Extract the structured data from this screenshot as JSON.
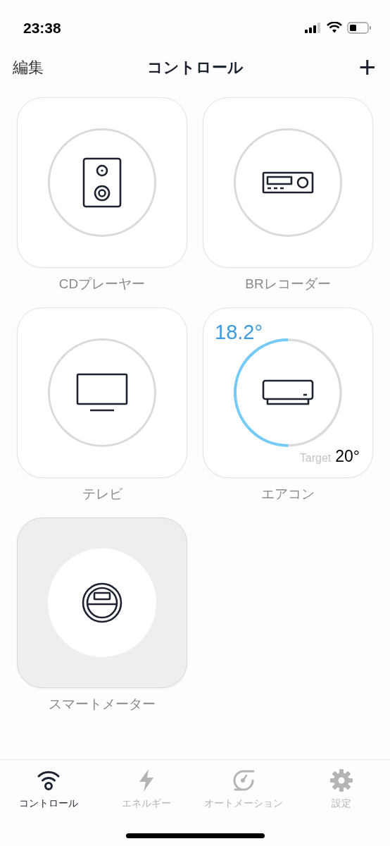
{
  "status_bar": {
    "time": "23:38"
  },
  "nav_bar": {
    "edit": "編集",
    "title": "コントロール",
    "add": "+"
  },
  "devices": [
    {
      "kind": "speaker",
      "name": "CDプレーヤー",
      "highlighted": false
    },
    {
      "kind": "recorder",
      "name": "BRレコーダー",
      "highlighted": false
    },
    {
      "kind": "tv",
      "name": "テレビ",
      "highlighted": false
    },
    {
      "kind": "aircon",
      "name": "エアコン",
      "highlighted": false
    },
    {
      "kind": "meter",
      "name": "スマートメーター",
      "highlighted": true
    }
  ],
  "aircon_gauge": {
    "reading": "18.2°",
    "target_label": "Target",
    "target": "20°",
    "level": 0.5
  },
  "tabs": [
    {
      "kind": "control",
      "label": "コントロール",
      "selected": true
    },
    {
      "kind": "energy",
      "label": "エネルギー",
      "selected": false
    },
    {
      "kind": "automation",
      "label": "オートメーション",
      "selected": false
    },
    {
      "kind": "settings",
      "label": "設定",
      "selected": false
    }
  ]
}
